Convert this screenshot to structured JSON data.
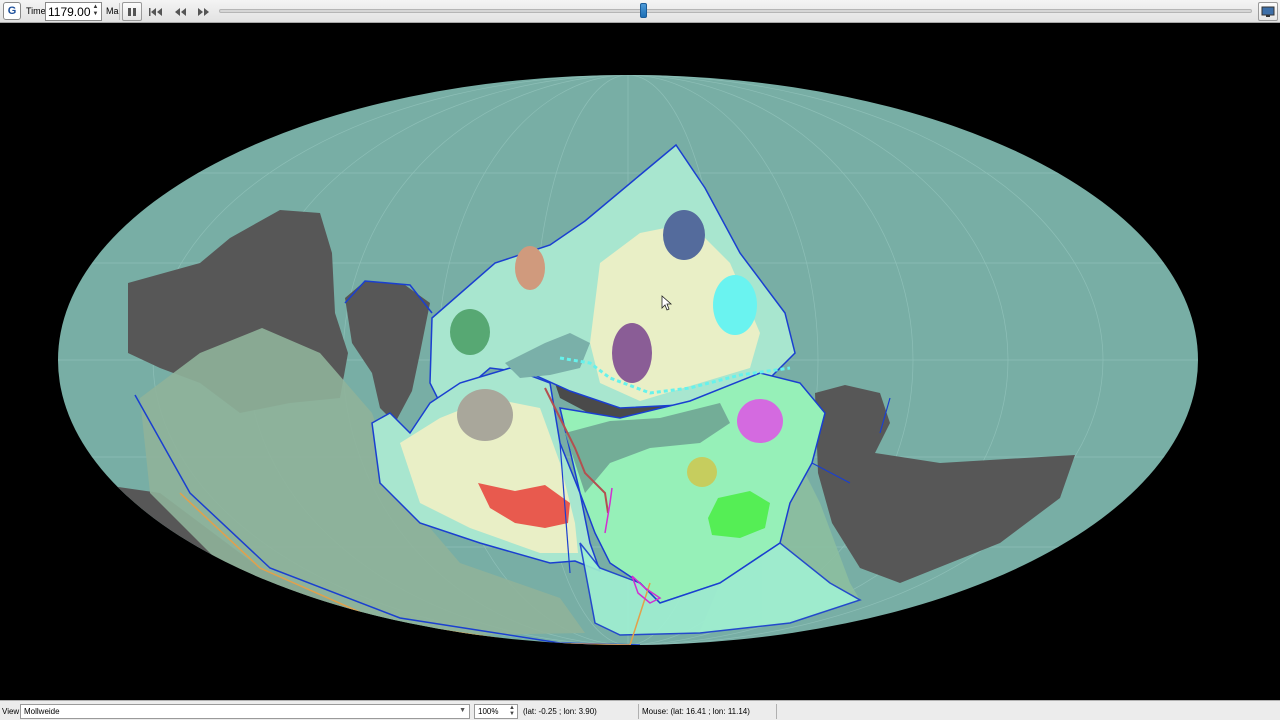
{
  "toolbar": {
    "logo": "G",
    "time_label": "Time:",
    "time_value": "1179.00",
    "time_unit": "Ma",
    "slider_position_fraction": 0.41
  },
  "globe": {
    "projection": "Mollweide",
    "colors": {
      "ocean": "#78aea5",
      "continent_dark": "#575757",
      "continent_sage": "#8fb39a",
      "plate_mint": "#a8e6cf",
      "plate_cream": "#f0efc4",
      "plate_green": "#96f0b8",
      "plate_boundary": "#1a3fd0",
      "ridge_cyan": "#66f2ec"
    },
    "blobs": [
      {
        "name": "blob-tan",
        "color": "#d09a7d"
      },
      {
        "name": "blob-navy",
        "color": "#546b9c"
      },
      {
        "name": "blob-cyan",
        "color": "#6af3f0"
      },
      {
        "name": "blob-green",
        "color": "#57a873"
      },
      {
        "name": "blob-purple",
        "color": "#8a5d96"
      },
      {
        "name": "blob-gray",
        "color": "#a9a79b"
      },
      {
        "name": "blob-magenta",
        "color": "#d46ae0"
      },
      {
        "name": "blob-olive",
        "color": "#c6cd5e"
      },
      {
        "name": "blob-red",
        "color": "#e85a4e"
      },
      {
        "name": "blob-lime",
        "color": "#55ee55"
      }
    ]
  },
  "statusbar": {
    "view_label": "View:",
    "view_value": "Mollweide",
    "zoom_value": "100%",
    "camera_coords": "(lat: -0.25 ; lon: 3.90)",
    "mouse_coords": "Mouse: (lat: 16.41 ; lon: 11.14)"
  }
}
